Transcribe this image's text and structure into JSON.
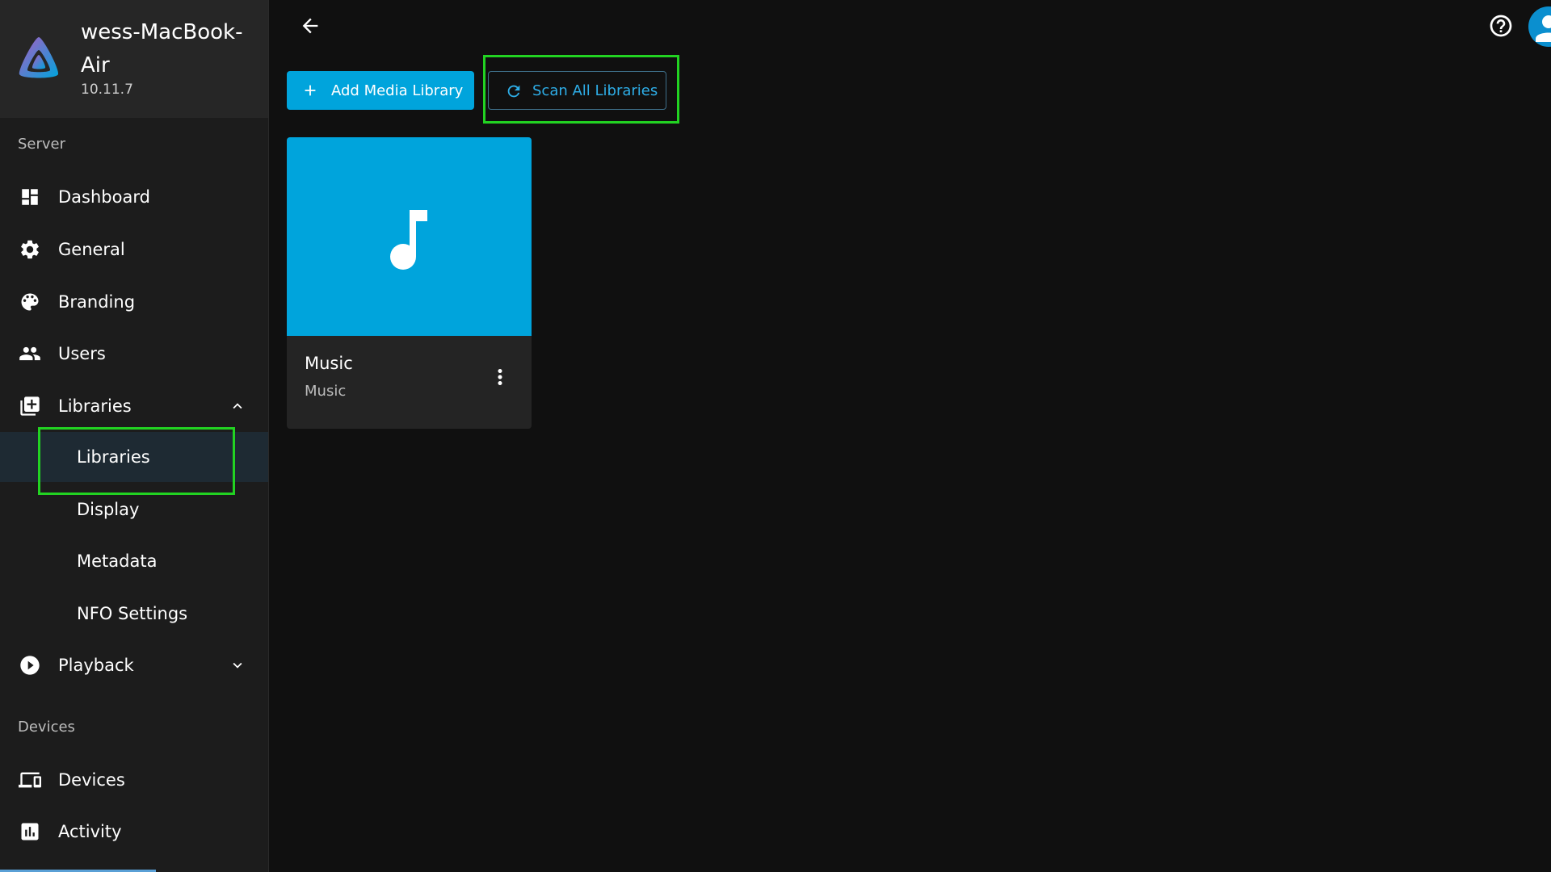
{
  "server": {
    "name": "wess-MacBook-Air",
    "version": "10.11.7"
  },
  "sidebar": {
    "server_section": "Server",
    "items": {
      "dashboard": "Dashboard",
      "general": "General",
      "branding": "Branding",
      "users": "Users",
      "libraries": "Libraries",
      "playback": "Playback"
    },
    "libraries_sub": {
      "libraries": "Libraries",
      "display": "Display",
      "metadata": "Metadata",
      "nfo": "NFO Settings"
    },
    "devices_section": "Devices",
    "devices_items": {
      "devices": "Devices",
      "activity": "Activity"
    }
  },
  "toolbar": {
    "add_label": "Add Media Library",
    "scan_label": "Scan All Libraries"
  },
  "libraries": [
    {
      "title": "Music",
      "type": "Music",
      "icon": "music-note-icon"
    }
  ],
  "colors": {
    "accent": "#00a4dc",
    "highlight": "#22d322",
    "sidebar_bg": "#1c1c1c",
    "page_bg": "#101010"
  }
}
